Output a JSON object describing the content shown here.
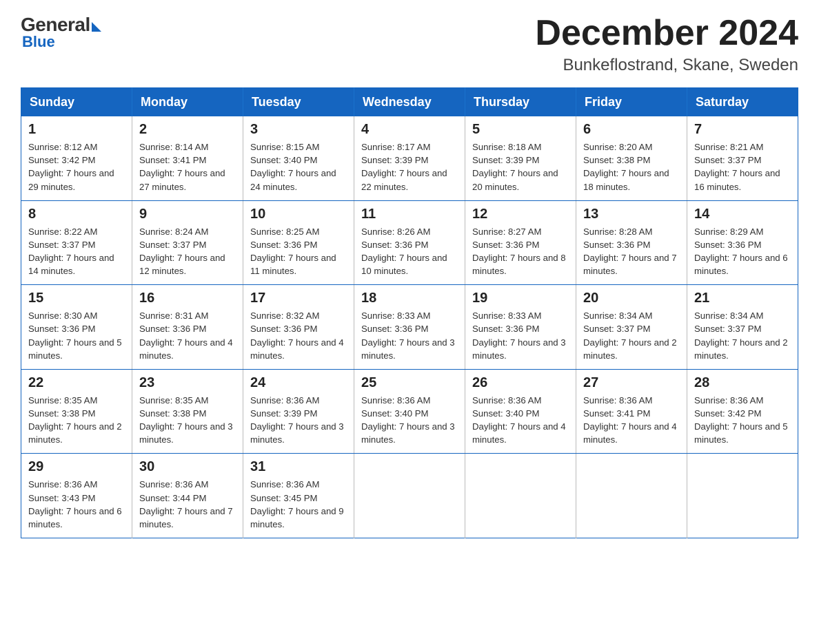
{
  "header": {
    "logo_general": "General",
    "logo_blue": "Blue",
    "title": "December 2024",
    "subtitle": "Bunkeflostrand, Skane, Sweden"
  },
  "weekdays": [
    "Sunday",
    "Monday",
    "Tuesday",
    "Wednesday",
    "Thursday",
    "Friday",
    "Saturday"
  ],
  "weeks": [
    [
      {
        "day": "1",
        "sunrise": "8:12 AM",
        "sunset": "3:42 PM",
        "daylight": "7 hours and 29 minutes."
      },
      {
        "day": "2",
        "sunrise": "8:14 AM",
        "sunset": "3:41 PM",
        "daylight": "7 hours and 27 minutes."
      },
      {
        "day": "3",
        "sunrise": "8:15 AM",
        "sunset": "3:40 PM",
        "daylight": "7 hours and 24 minutes."
      },
      {
        "day": "4",
        "sunrise": "8:17 AM",
        "sunset": "3:39 PM",
        "daylight": "7 hours and 22 minutes."
      },
      {
        "day": "5",
        "sunrise": "8:18 AM",
        "sunset": "3:39 PM",
        "daylight": "7 hours and 20 minutes."
      },
      {
        "day": "6",
        "sunrise": "8:20 AM",
        "sunset": "3:38 PM",
        "daylight": "7 hours and 18 minutes."
      },
      {
        "day": "7",
        "sunrise": "8:21 AM",
        "sunset": "3:37 PM",
        "daylight": "7 hours and 16 minutes."
      }
    ],
    [
      {
        "day": "8",
        "sunrise": "8:22 AM",
        "sunset": "3:37 PM",
        "daylight": "7 hours and 14 minutes."
      },
      {
        "day": "9",
        "sunrise": "8:24 AM",
        "sunset": "3:37 PM",
        "daylight": "7 hours and 12 minutes."
      },
      {
        "day": "10",
        "sunrise": "8:25 AM",
        "sunset": "3:36 PM",
        "daylight": "7 hours and 11 minutes."
      },
      {
        "day": "11",
        "sunrise": "8:26 AM",
        "sunset": "3:36 PM",
        "daylight": "7 hours and 10 minutes."
      },
      {
        "day": "12",
        "sunrise": "8:27 AM",
        "sunset": "3:36 PM",
        "daylight": "7 hours and 8 minutes."
      },
      {
        "day": "13",
        "sunrise": "8:28 AM",
        "sunset": "3:36 PM",
        "daylight": "7 hours and 7 minutes."
      },
      {
        "day": "14",
        "sunrise": "8:29 AM",
        "sunset": "3:36 PM",
        "daylight": "7 hours and 6 minutes."
      }
    ],
    [
      {
        "day": "15",
        "sunrise": "8:30 AM",
        "sunset": "3:36 PM",
        "daylight": "7 hours and 5 minutes."
      },
      {
        "day": "16",
        "sunrise": "8:31 AM",
        "sunset": "3:36 PM",
        "daylight": "7 hours and 4 minutes."
      },
      {
        "day": "17",
        "sunrise": "8:32 AM",
        "sunset": "3:36 PM",
        "daylight": "7 hours and 4 minutes."
      },
      {
        "day": "18",
        "sunrise": "8:33 AM",
        "sunset": "3:36 PM",
        "daylight": "7 hours and 3 minutes."
      },
      {
        "day": "19",
        "sunrise": "8:33 AM",
        "sunset": "3:36 PM",
        "daylight": "7 hours and 3 minutes."
      },
      {
        "day": "20",
        "sunrise": "8:34 AM",
        "sunset": "3:37 PM",
        "daylight": "7 hours and 2 minutes."
      },
      {
        "day": "21",
        "sunrise": "8:34 AM",
        "sunset": "3:37 PM",
        "daylight": "7 hours and 2 minutes."
      }
    ],
    [
      {
        "day": "22",
        "sunrise": "8:35 AM",
        "sunset": "3:38 PM",
        "daylight": "7 hours and 2 minutes."
      },
      {
        "day": "23",
        "sunrise": "8:35 AM",
        "sunset": "3:38 PM",
        "daylight": "7 hours and 3 minutes."
      },
      {
        "day": "24",
        "sunrise": "8:36 AM",
        "sunset": "3:39 PM",
        "daylight": "7 hours and 3 minutes."
      },
      {
        "day": "25",
        "sunrise": "8:36 AM",
        "sunset": "3:40 PM",
        "daylight": "7 hours and 3 minutes."
      },
      {
        "day": "26",
        "sunrise": "8:36 AM",
        "sunset": "3:40 PM",
        "daylight": "7 hours and 4 minutes."
      },
      {
        "day": "27",
        "sunrise": "8:36 AM",
        "sunset": "3:41 PM",
        "daylight": "7 hours and 4 minutes."
      },
      {
        "day": "28",
        "sunrise": "8:36 AM",
        "sunset": "3:42 PM",
        "daylight": "7 hours and 5 minutes."
      }
    ],
    [
      {
        "day": "29",
        "sunrise": "8:36 AM",
        "sunset": "3:43 PM",
        "daylight": "7 hours and 6 minutes."
      },
      {
        "day": "30",
        "sunrise": "8:36 AM",
        "sunset": "3:44 PM",
        "daylight": "7 hours and 7 minutes."
      },
      {
        "day": "31",
        "sunrise": "8:36 AM",
        "sunset": "3:45 PM",
        "daylight": "7 hours and 9 minutes."
      },
      null,
      null,
      null,
      null
    ]
  ]
}
